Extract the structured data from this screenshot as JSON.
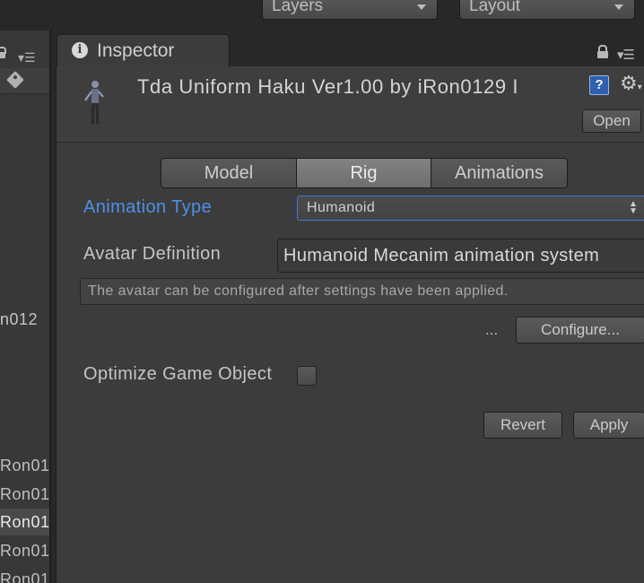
{
  "toolbar": {
    "layers_label": "Layers",
    "layout_label": "Layout"
  },
  "left_panel": {
    "partial_label": "n012",
    "rows": [
      "Ron01",
      "Ron01",
      "Ron01",
      "Ron01",
      "Ron01"
    ],
    "selected_row_index": 2
  },
  "inspector": {
    "tab_title": "Inspector",
    "asset_title": "Tda Uniform Haku Ver1.00 by iRon0129 I",
    "open_label": "Open",
    "tabs": [
      {
        "label": "Model",
        "active": false
      },
      {
        "label": "Rig",
        "active": true
      },
      {
        "label": "Animations",
        "active": false
      }
    ],
    "animation_type_label": "Animation Type",
    "animation_type_value": "Humanoid",
    "avatar_definition_label": "Avatar Definition",
    "avatar_definition_value": "Humanoid Mecanim animation system",
    "help_text": "The avatar can be configured after settings have been applied.",
    "ellipsis": "...",
    "configure_label": "Configure...",
    "optimize_label": "Optimize Game Object",
    "optimize_checked": false,
    "revert_label": "Revert",
    "apply_label": "Apply"
  },
  "colors": {
    "background": "#282828",
    "panel": "#3c3c3c",
    "accent_blue": "#4f8fe8",
    "focus_border": "#3d7ae0"
  },
  "icons": {
    "info": "info-icon",
    "lock": "lock-icon",
    "menu": "menu-icon",
    "tag": "tag-icon",
    "help": "help-icon",
    "gear": "gear-icon",
    "asset": "model-asset-icon"
  }
}
